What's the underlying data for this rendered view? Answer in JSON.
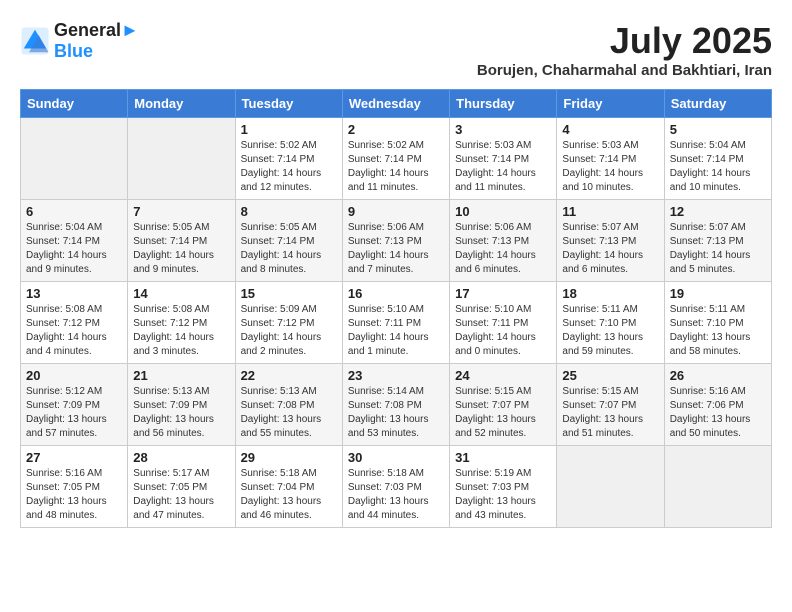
{
  "header": {
    "logo_line1": "General",
    "logo_line2": "Blue",
    "month_year": "July 2025",
    "subtitle": "Borujen, Chaharmahal and Bakhtiari, Iran"
  },
  "columns": [
    "Sunday",
    "Monday",
    "Tuesday",
    "Wednesday",
    "Thursday",
    "Friday",
    "Saturday"
  ],
  "weeks": [
    [
      {
        "day": "",
        "sunrise": "",
        "sunset": "",
        "daylight": ""
      },
      {
        "day": "",
        "sunrise": "",
        "sunset": "",
        "daylight": ""
      },
      {
        "day": "1",
        "sunrise": "Sunrise: 5:02 AM",
        "sunset": "Sunset: 7:14 PM",
        "daylight": "Daylight: 14 hours and 12 minutes."
      },
      {
        "day": "2",
        "sunrise": "Sunrise: 5:02 AM",
        "sunset": "Sunset: 7:14 PM",
        "daylight": "Daylight: 14 hours and 11 minutes."
      },
      {
        "day": "3",
        "sunrise": "Sunrise: 5:03 AM",
        "sunset": "Sunset: 7:14 PM",
        "daylight": "Daylight: 14 hours and 11 minutes."
      },
      {
        "day": "4",
        "sunrise": "Sunrise: 5:03 AM",
        "sunset": "Sunset: 7:14 PM",
        "daylight": "Daylight: 14 hours and 10 minutes."
      },
      {
        "day": "5",
        "sunrise": "Sunrise: 5:04 AM",
        "sunset": "Sunset: 7:14 PM",
        "daylight": "Daylight: 14 hours and 10 minutes."
      }
    ],
    [
      {
        "day": "6",
        "sunrise": "Sunrise: 5:04 AM",
        "sunset": "Sunset: 7:14 PM",
        "daylight": "Daylight: 14 hours and 9 minutes."
      },
      {
        "day": "7",
        "sunrise": "Sunrise: 5:05 AM",
        "sunset": "Sunset: 7:14 PM",
        "daylight": "Daylight: 14 hours and 9 minutes."
      },
      {
        "day": "8",
        "sunrise": "Sunrise: 5:05 AM",
        "sunset": "Sunset: 7:14 PM",
        "daylight": "Daylight: 14 hours and 8 minutes."
      },
      {
        "day": "9",
        "sunrise": "Sunrise: 5:06 AM",
        "sunset": "Sunset: 7:13 PM",
        "daylight": "Daylight: 14 hours and 7 minutes."
      },
      {
        "day": "10",
        "sunrise": "Sunrise: 5:06 AM",
        "sunset": "Sunset: 7:13 PM",
        "daylight": "Daylight: 14 hours and 6 minutes."
      },
      {
        "day": "11",
        "sunrise": "Sunrise: 5:07 AM",
        "sunset": "Sunset: 7:13 PM",
        "daylight": "Daylight: 14 hours and 6 minutes."
      },
      {
        "day": "12",
        "sunrise": "Sunrise: 5:07 AM",
        "sunset": "Sunset: 7:13 PM",
        "daylight": "Daylight: 14 hours and 5 minutes."
      }
    ],
    [
      {
        "day": "13",
        "sunrise": "Sunrise: 5:08 AM",
        "sunset": "Sunset: 7:12 PM",
        "daylight": "Daylight: 14 hours and 4 minutes."
      },
      {
        "day": "14",
        "sunrise": "Sunrise: 5:08 AM",
        "sunset": "Sunset: 7:12 PM",
        "daylight": "Daylight: 14 hours and 3 minutes."
      },
      {
        "day": "15",
        "sunrise": "Sunrise: 5:09 AM",
        "sunset": "Sunset: 7:12 PM",
        "daylight": "Daylight: 14 hours and 2 minutes."
      },
      {
        "day": "16",
        "sunrise": "Sunrise: 5:10 AM",
        "sunset": "Sunset: 7:11 PM",
        "daylight": "Daylight: 14 hours and 1 minute."
      },
      {
        "day": "17",
        "sunrise": "Sunrise: 5:10 AM",
        "sunset": "Sunset: 7:11 PM",
        "daylight": "Daylight: 14 hours and 0 minutes."
      },
      {
        "day": "18",
        "sunrise": "Sunrise: 5:11 AM",
        "sunset": "Sunset: 7:10 PM",
        "daylight": "Daylight: 13 hours and 59 minutes."
      },
      {
        "day": "19",
        "sunrise": "Sunrise: 5:11 AM",
        "sunset": "Sunset: 7:10 PM",
        "daylight": "Daylight: 13 hours and 58 minutes."
      }
    ],
    [
      {
        "day": "20",
        "sunrise": "Sunrise: 5:12 AM",
        "sunset": "Sunset: 7:09 PM",
        "daylight": "Daylight: 13 hours and 57 minutes."
      },
      {
        "day": "21",
        "sunrise": "Sunrise: 5:13 AM",
        "sunset": "Sunset: 7:09 PM",
        "daylight": "Daylight: 13 hours and 56 minutes."
      },
      {
        "day": "22",
        "sunrise": "Sunrise: 5:13 AM",
        "sunset": "Sunset: 7:08 PM",
        "daylight": "Daylight: 13 hours and 55 minutes."
      },
      {
        "day": "23",
        "sunrise": "Sunrise: 5:14 AM",
        "sunset": "Sunset: 7:08 PM",
        "daylight": "Daylight: 13 hours and 53 minutes."
      },
      {
        "day": "24",
        "sunrise": "Sunrise: 5:15 AM",
        "sunset": "Sunset: 7:07 PM",
        "daylight": "Daylight: 13 hours and 52 minutes."
      },
      {
        "day": "25",
        "sunrise": "Sunrise: 5:15 AM",
        "sunset": "Sunset: 7:07 PM",
        "daylight": "Daylight: 13 hours and 51 minutes."
      },
      {
        "day": "26",
        "sunrise": "Sunrise: 5:16 AM",
        "sunset": "Sunset: 7:06 PM",
        "daylight": "Daylight: 13 hours and 50 minutes."
      }
    ],
    [
      {
        "day": "27",
        "sunrise": "Sunrise: 5:16 AM",
        "sunset": "Sunset: 7:05 PM",
        "daylight": "Daylight: 13 hours and 48 minutes."
      },
      {
        "day": "28",
        "sunrise": "Sunrise: 5:17 AM",
        "sunset": "Sunset: 7:05 PM",
        "daylight": "Daylight: 13 hours and 47 minutes."
      },
      {
        "day": "29",
        "sunrise": "Sunrise: 5:18 AM",
        "sunset": "Sunset: 7:04 PM",
        "daylight": "Daylight: 13 hours and 46 minutes."
      },
      {
        "day": "30",
        "sunrise": "Sunrise: 5:18 AM",
        "sunset": "Sunset: 7:03 PM",
        "daylight": "Daylight: 13 hours and 44 minutes."
      },
      {
        "day": "31",
        "sunrise": "Sunrise: 5:19 AM",
        "sunset": "Sunset: 7:03 PM",
        "daylight": "Daylight: 13 hours and 43 minutes."
      },
      {
        "day": "",
        "sunrise": "",
        "sunset": "",
        "daylight": ""
      },
      {
        "day": "",
        "sunrise": "",
        "sunset": "",
        "daylight": ""
      }
    ]
  ]
}
